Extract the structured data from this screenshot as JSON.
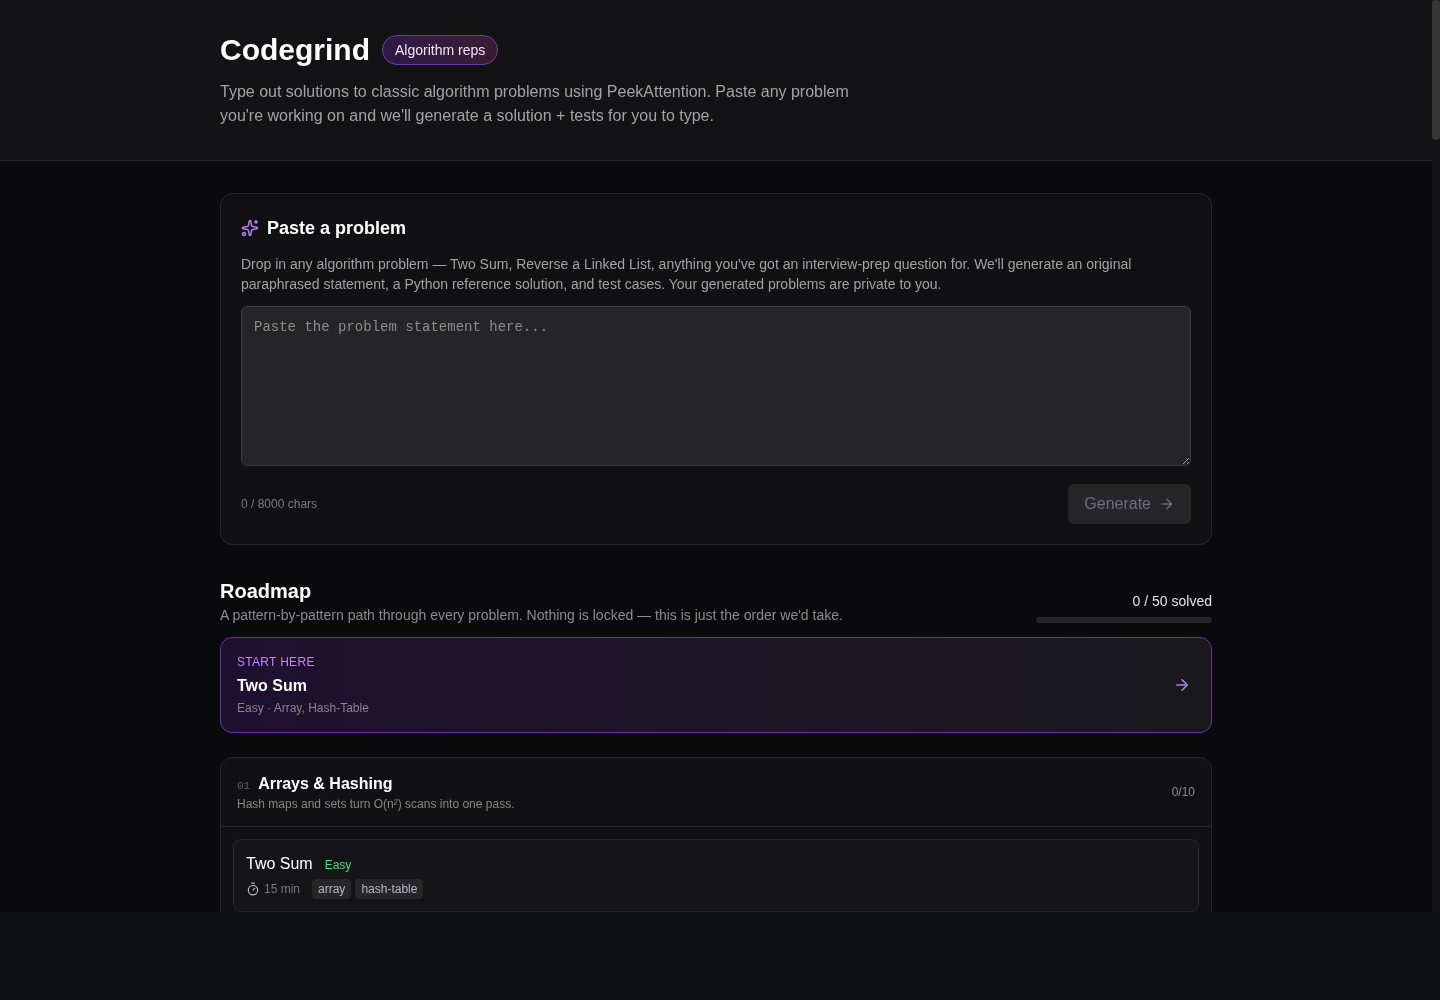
{
  "header": {
    "title": "Codegrind",
    "badge": "Algorithm reps",
    "description": "Type out solutions to classic algorithm problems using PeekAttention. Paste any problem you're working on and we'll generate a solution + tests for you to type."
  },
  "paste_card": {
    "title": "Paste a problem",
    "description": "Drop in any algorithm problem — Two Sum, Reverse a Linked List, anything you've got an interview-prep question for. We'll generate an original paraphrased statement, a Python reference solution, and test cases. Your generated problems are private to you.",
    "textarea": {
      "placeholder": "Paste the problem statement here..."
    },
    "char_count": "0 / 8000 chars",
    "generate_button": {
      "label": "Generate",
      "disabled": true
    }
  },
  "roadmap": {
    "title": "Roadmap",
    "subtitle": "A pattern-by-pattern path through every problem. Nothing is locked — this is just the order we'd take.",
    "progress": {
      "label": "0 / 50 solved",
      "level": 0
    },
    "start_card": {
      "eyebrow": "START HERE",
      "title": "Two Sum",
      "meta": "Easy · Array, Hash-Table"
    },
    "sections": [
      {
        "number": "01",
        "title": "Arrays & Hashing",
        "description": "Hash maps and sets turn O(n²) scans into one pass.",
        "count": "0/10",
        "problems": [
          {
            "title": "Two Sum",
            "difficulty": {
              "label": "Easy",
              "color": "#4ade80"
            },
            "time": "15 min",
            "tags": [
              "array",
              "hash-table"
            ]
          }
        ]
      }
    ]
  }
}
